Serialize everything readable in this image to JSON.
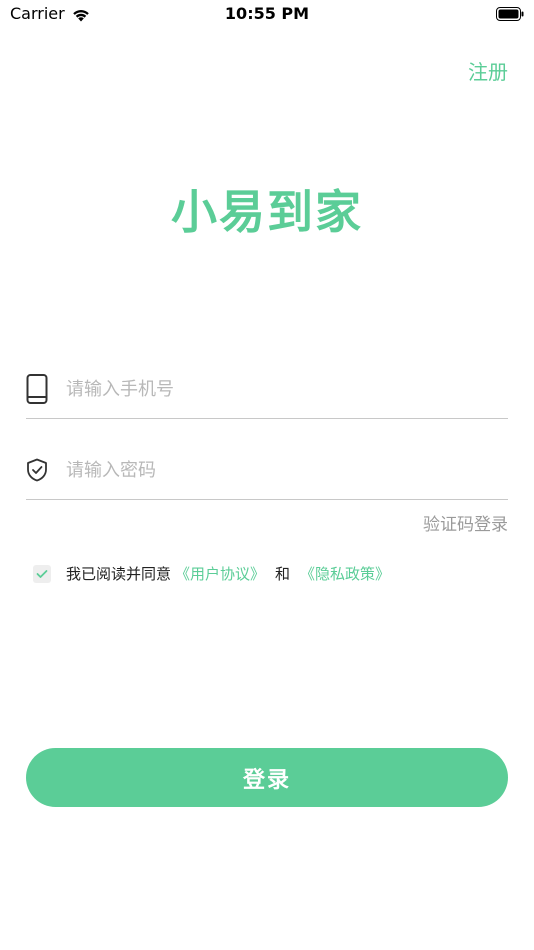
{
  "status_bar": {
    "carrier": "Carrier",
    "time": "10:55 PM"
  },
  "header": {
    "register_label": "注册"
  },
  "app": {
    "title": "小易到家",
    "accent_color": "#5bcd97"
  },
  "form": {
    "phone": {
      "icon": "phone-icon",
      "placeholder": "请输入手机号",
      "value": ""
    },
    "password": {
      "icon": "shield-icon",
      "placeholder": "请输入密码",
      "value": ""
    },
    "sms_login_label": "验证码登录"
  },
  "agreement": {
    "checked": true,
    "prefix": "我已阅读并同意",
    "user_agreement": "《用户协议》",
    "conjunction": "和",
    "privacy_policy": "《隐私政策》"
  },
  "login_button": {
    "label": "登录"
  }
}
